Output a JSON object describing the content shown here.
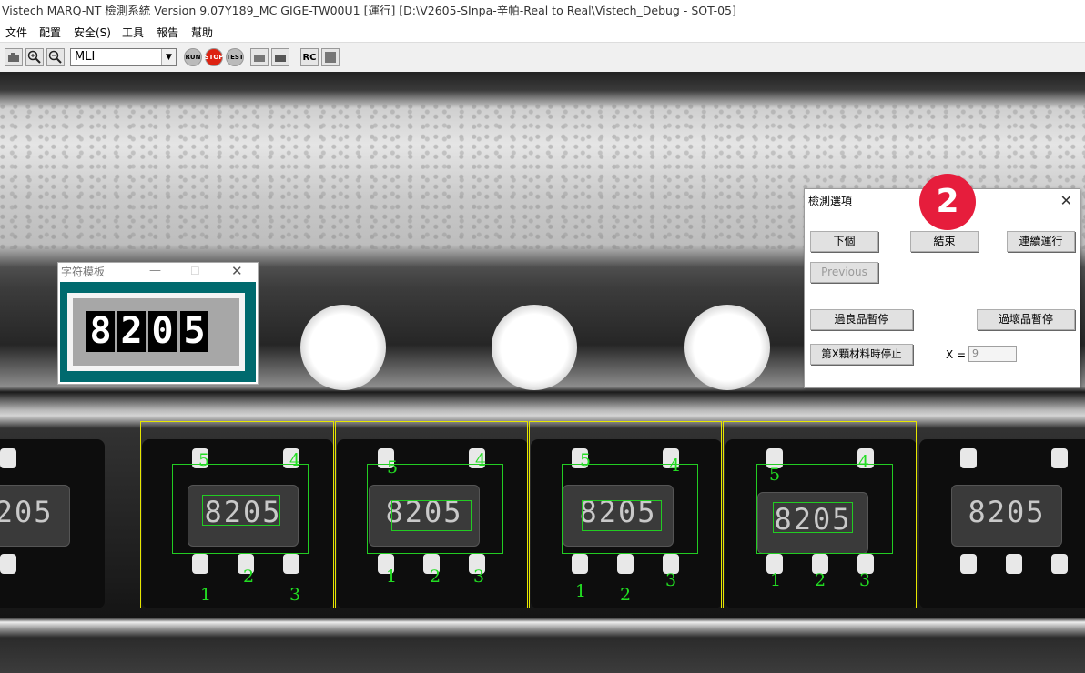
{
  "window": {
    "title": "Vistech MARQ-NT 檢測系統 Version 9.07Y189_MC GIGE-TW00U1 [運行] [D:\\V2605-SInpa-辛帕-Real to Real\\Vistech_Debug - SOT-05]"
  },
  "menu": [
    "文件",
    "配置",
    "安全(S)",
    "工具",
    "報告",
    "幫助"
  ],
  "toolbar": {
    "mode_value": "MLI",
    "run_label": "RUN",
    "stop_label": "STOP",
    "test_label": "TEST",
    "rc_label": "RC"
  },
  "template_window": {
    "title": "字符模板",
    "chars": [
      "8",
      "2",
      "0",
      "5"
    ]
  },
  "image": {
    "chip_marking": "8205",
    "pin_numbers_top": [
      "5",
      "4"
    ],
    "pin_numbers_bottom": [
      "1",
      "2",
      "3"
    ]
  },
  "badge": {
    "number": "2"
  },
  "options_dialog": {
    "title": "檢測選項",
    "next_label": "下個",
    "end_label": "結束",
    "continuous_label": "連續運行",
    "previous_label": "Previous",
    "good_pause_label": "過良品暫停",
    "bad_pause_label": "過壞品暫停",
    "stop_nth_label": "第X顆材料時停止",
    "x_label": "X =",
    "x_value": "9"
  }
}
